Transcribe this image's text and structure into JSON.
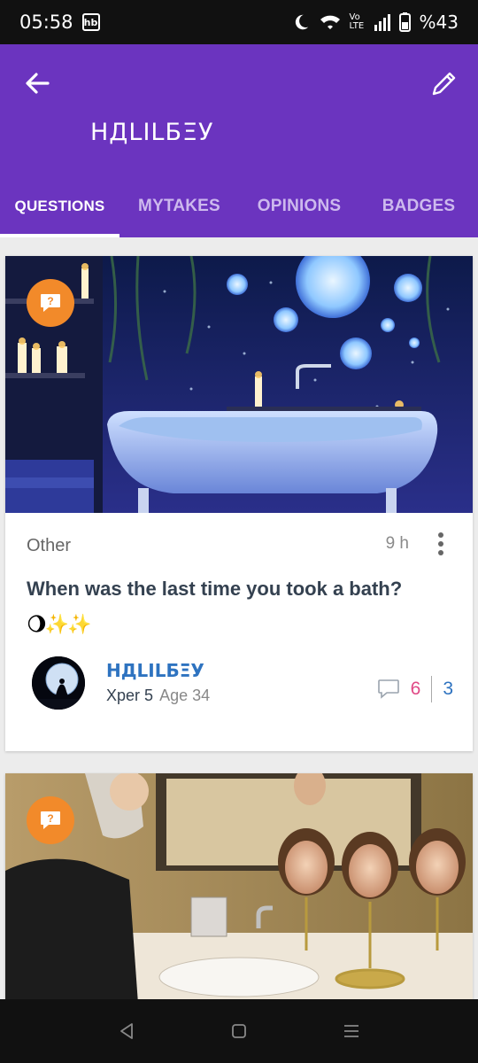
{
  "status_bar": {
    "time": "05:58",
    "badge": "hb",
    "battery": "%43",
    "network": "Vo LTE"
  },
  "header": {
    "title": "НДLILБΞУ",
    "back_icon": "arrow-left-icon",
    "edit_icon": "pencil-icon"
  },
  "tabs": [
    {
      "label": "QUESTIONS",
      "active": true
    },
    {
      "label": "MYTAKES",
      "active": false
    },
    {
      "label": "OPINIONS",
      "active": false
    },
    {
      "label": "BADGES",
      "active": false
    }
  ],
  "posts": [
    {
      "category": "Other",
      "time": "9 h",
      "question": "When was the last time you took a bath?",
      "emoji": "🌖✨✨",
      "author": {
        "name": "НДLILБΞУ",
        "level": "Xper 5",
        "age": "Age 34"
      },
      "opinion_count": "6",
      "other_count": "3"
    }
  ],
  "colors": {
    "primary": "#6b34bf",
    "badge": "#f28a2a",
    "link": "#2e73c0",
    "opinions": "#e04a86"
  }
}
